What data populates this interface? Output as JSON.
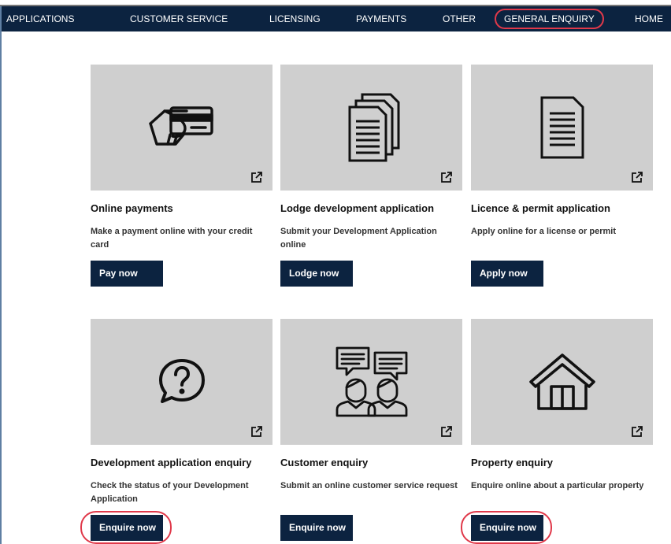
{
  "nav": {
    "items": [
      "APPLICATIONS",
      "CUSTOMER SERVICE",
      "LICENSING",
      "PAYMENTS",
      "OTHER",
      "GENERAL ENQUIRY",
      "HOME"
    ],
    "highlighted": "GENERAL ENQUIRY"
  },
  "cards": [
    {
      "title": "Online payments",
      "description": "Make a payment online with your credit card",
      "button": "Pay now",
      "icon": "credit-card-hand-icon",
      "highlighted": false
    },
    {
      "title": "Lodge development application",
      "description": "Submit your Development Application online",
      "button": "Lodge now",
      "icon": "documents-stack-icon",
      "highlighted": false
    },
    {
      "title": "Licence & permit application",
      "description": "Apply online for a license or permit",
      "button": "Apply now",
      "icon": "document-icon",
      "highlighted": false
    },
    {
      "title": "Development application enquiry",
      "description": "Check the status of your Development Application",
      "button": "Enquire now",
      "icon": "question-bubble-icon",
      "highlighted": true
    },
    {
      "title": "Customer enquiry",
      "description": "Submit an online customer service request",
      "button": "Enquire now",
      "icon": "people-chat-icon",
      "highlighted": false
    },
    {
      "title": "Property enquiry",
      "description": "Enquire online about a particular property",
      "button": "Enquire now",
      "icon": "house-icon",
      "highlighted": true
    }
  ],
  "colors": {
    "navy": "#0c2340",
    "card_bg": "#cfcfcf",
    "highlight": "#e0394a"
  }
}
